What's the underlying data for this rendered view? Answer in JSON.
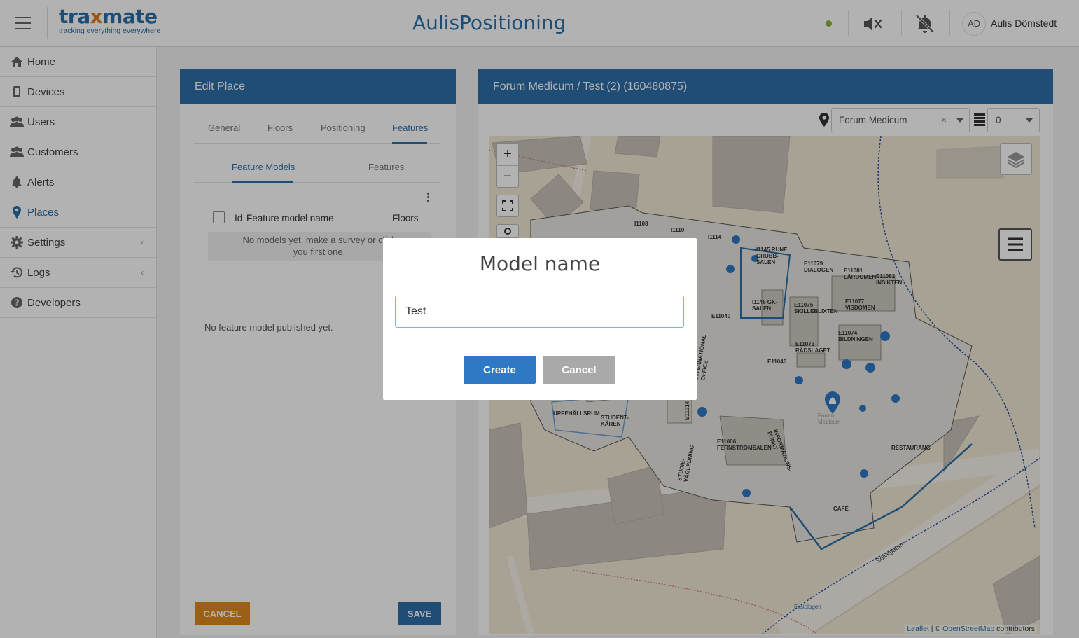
{
  "header": {
    "logo_main_a": "tra",
    "logo_main_x": "x",
    "logo_main_b": "mate",
    "logo_sub": "tracking everything everywhere",
    "app_title": "AulisPositioning",
    "user_initials": "AD",
    "user_name": "Aulis Dömstedt",
    "status_color": "#8bb43a"
  },
  "sidebar": {
    "items": [
      {
        "label": "Home",
        "icon": "home-icon"
      },
      {
        "label": "Devices",
        "icon": "phone-icon"
      },
      {
        "label": "Users",
        "icon": "users-icon"
      },
      {
        "label": "Customers",
        "icon": "customers-icon"
      },
      {
        "label": "Alerts",
        "icon": "bell-icon"
      },
      {
        "label": "Places",
        "icon": "map-pin-icon",
        "active": true
      },
      {
        "label": "Settings",
        "icon": "gear-icon",
        "expandable": true
      },
      {
        "label": "Logs",
        "icon": "history-icon",
        "expandable": true
      },
      {
        "label": "Developers",
        "icon": "help-icon"
      }
    ]
  },
  "edit_place": {
    "title": "Edit Place",
    "tabs": [
      "General",
      "Floors",
      "Positioning",
      "Features"
    ],
    "active_tab": "Features",
    "subtabs": [
      "Feature Models",
      "Features"
    ],
    "active_subtab": "Feature Models",
    "table": {
      "col_id": "Id",
      "col_name": "Feature model name",
      "col_floors": "Floors",
      "empty_line1": "No models yet, make a survey or click",
      "empty_line2": "you first one."
    },
    "no_published": "No feature model published yet.",
    "cancel_label": "CANCEL",
    "save_label": "SAVE"
  },
  "map_panel": {
    "title": "Forum Medicum / Test (2) (160480875)",
    "place_value": "Forum Medicum",
    "clear_symbol": "×",
    "floor_value": "0",
    "zoom_in": "+",
    "zoom_out": "−",
    "attribution": {
      "leaflet": "Leaflet",
      "separator": " | © ",
      "osm": "OpenStreetMap",
      "suffix": " contributors"
    },
    "labels": {
      "restaurang": "RESTAURANG",
      "cafe": "CAFÉ",
      "street": "Sölvegatan",
      "uppehallsrum": "UPPEHÅLLSRUM",
      "studentkaren": "STUDENT-KÅREN",
      "fernstrom": "E11006 FERNSTRÖMSALEN",
      "dialogen": "E11079 DIALOGEN",
      "lardomen": "E11081 LÄRDOMEN",
      "insikten": "E11082 INSIKTEN",
      "visdomen": "E11077 VISDOMEN",
      "skillebl": "E11075 SKILLEBLIXTEN",
      "radslaget": "E11073 RÅDSLAGET",
      "bildningen": "E11074 BILDNINGEN",
      "i1145": "I1145 RUNE GRUBB-SALEN",
      "i1146": "I1146 GK-SALEN",
      "i1108": "I1108",
      "i1110": "I1110",
      "i1114": "I1114",
      "e11040": "E11040",
      "e11046": "E11046",
      "e11014": "E11014",
      "intl": "INTERNATIONAL OFFICE",
      "studie": "STUDIE-VÄGLEDNING",
      "info": "INFORMATIONS-PUNKT",
      "fysiologen": "Fysiologen",
      "forum": "Forum Medicum"
    }
  },
  "modal": {
    "title": "Model name",
    "input_value": "Test",
    "create_label": "Create",
    "cancel_label": "Cancel"
  }
}
